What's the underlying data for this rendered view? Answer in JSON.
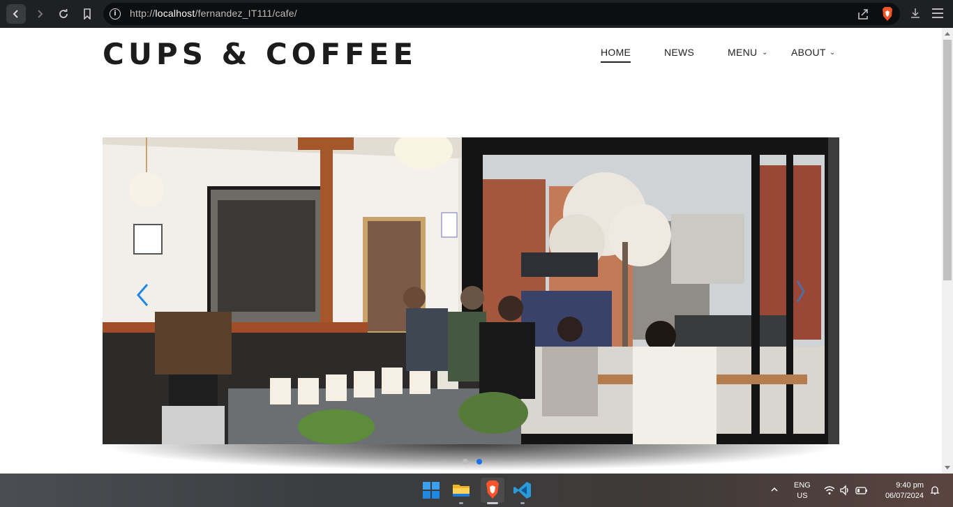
{
  "browser": {
    "url_prefix": "http://",
    "url_host": "localhost",
    "url_path": "/fernandez_IT111/cafe/"
  },
  "site": {
    "logo": "CUPS & COFFEE",
    "nav": [
      {
        "label": "HOME",
        "active": true
      },
      {
        "label": "NEWS",
        "active": false
      },
      {
        "label": "MENU",
        "has_dropdown": true
      },
      {
        "label": "ABOUT",
        "has_dropdown": true
      }
    ]
  },
  "slider": {
    "slide_count": 2,
    "active_index": 1,
    "colors": {
      "active_dot": "#1a73e8",
      "inactive_dot": "#bdbdbd",
      "arrow": "#1e88e5"
    }
  },
  "taskbar": {
    "pinned": [
      "windows-start-icon",
      "file-explorer-icon",
      "brave-browser-icon",
      "vscode-icon"
    ],
    "lang_line1": "ENG",
    "lang_line2": "US",
    "time": "9:40 pm",
    "date": "06/07/2024"
  }
}
